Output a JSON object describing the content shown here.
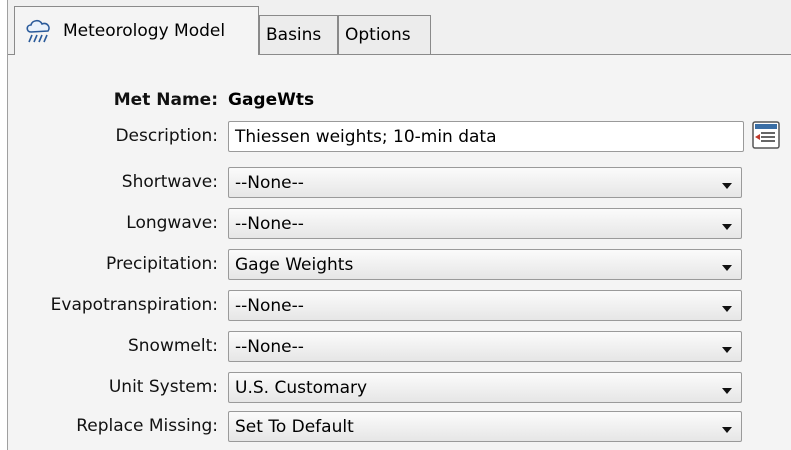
{
  "tabs": [
    {
      "label": "Meteorology Model",
      "icon": "meteorology-icon",
      "active": true
    },
    {
      "label": "Basins",
      "active": false
    },
    {
      "label": "Options",
      "active": false
    }
  ],
  "form": {
    "met_name_label": "Met Name:",
    "met_name_value": "GageWts",
    "description_label": "Description:",
    "description_value": "Thiessen weights; 10-min data",
    "shortwave_label": "Shortwave:",
    "shortwave_value": "--None--",
    "longwave_label": "Longwave:",
    "longwave_value": "--None--",
    "precipitation_label": "Precipitation:",
    "precipitation_value": "Gage Weights",
    "evapotranspiration_label": "Evapotranspiration:",
    "evapotranspiration_value": "--None--",
    "snowmelt_label": "Snowmelt:",
    "snowmelt_value": "--None--",
    "unit_system_label": "Unit System:",
    "unit_system_value": "U.S. Customary",
    "replace_missing_label": "Replace Missing:",
    "replace_missing_value": "Set To Default"
  },
  "icons": {
    "description_editor": "text-editor-icon"
  }
}
